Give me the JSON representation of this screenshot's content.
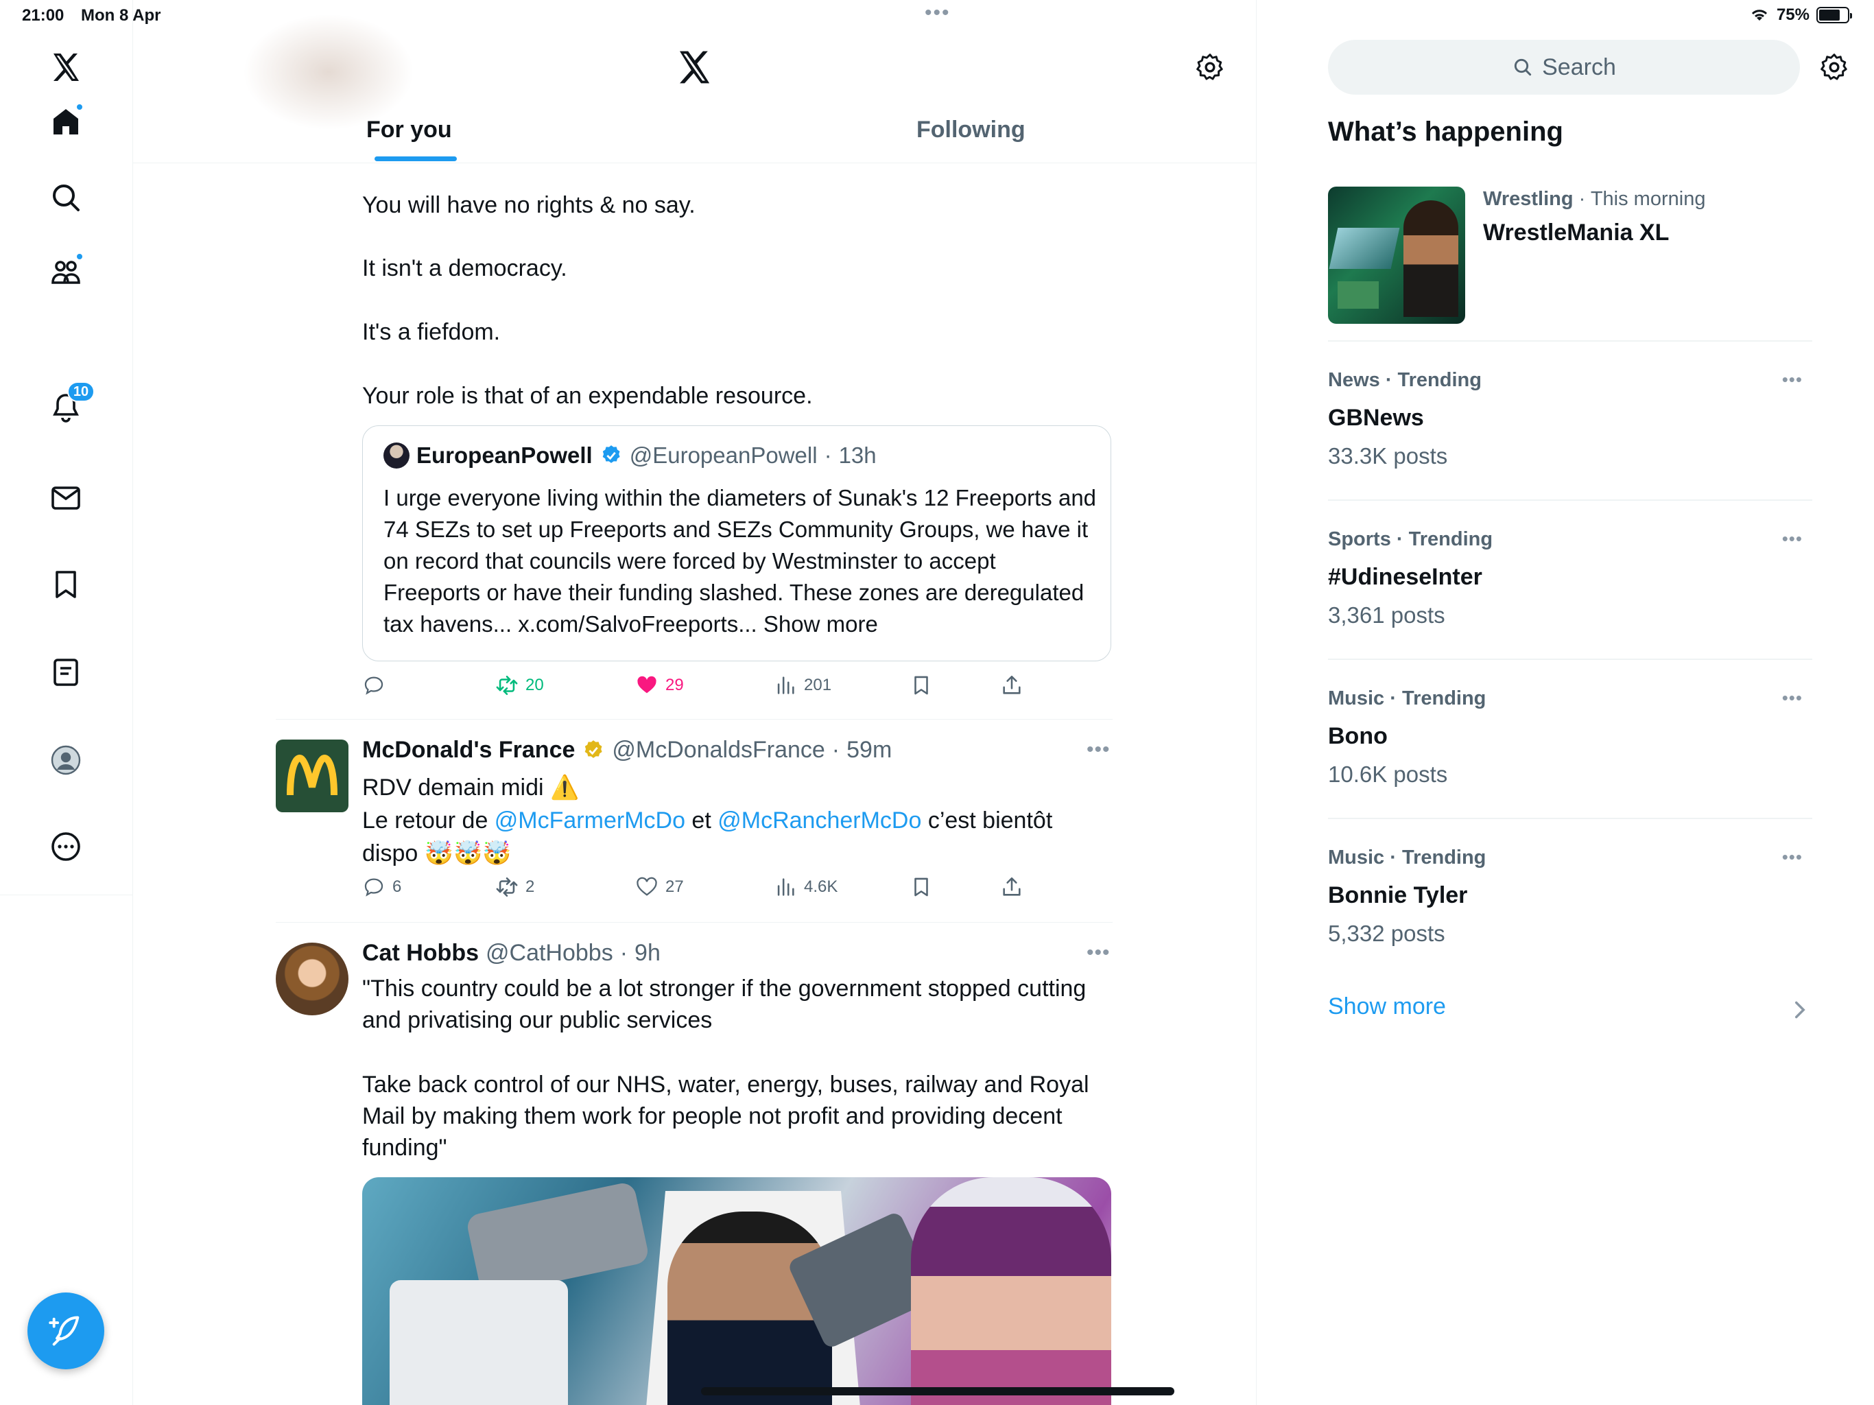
{
  "status": {
    "time": "21:00",
    "date": "Mon 8 Apr",
    "battery": "75%",
    "battery_level": 0.75
  },
  "nav": {
    "notifications_badge": "10",
    "icons": [
      "x-logo-icon",
      "home-icon",
      "search-icon",
      "communities-icon",
      "bell-icon",
      "mail-icon",
      "bookmark-icon",
      "lists-icon",
      "profile-icon",
      "more-icon"
    ]
  },
  "header": {
    "tabs": [
      {
        "label": "For you",
        "active": true
      },
      {
        "label": "Following",
        "active": false
      }
    ]
  },
  "tweet1": {
    "lines": [
      "You will have no rights & no say.",
      "It isn't a democracy.",
      "It's a fiefdom.",
      "Your role is that of an expendable resource."
    ],
    "quote": {
      "name": "EuropeanPowell",
      "handle": "@EuropeanPowell",
      "time": "13h",
      "body": "I urge everyone living within the diameters of Sunak's 12 Freeports and 74 SEZs to set up Freeports and SEZs Community Groups, we have it on record that councils were forced by Westminster to accept Freeports or have their funding slashed. These zones are deregulated tax havens... x.com/SalvoFreeports... Show more"
    },
    "reposts": "20",
    "likes": "29",
    "views": "201"
  },
  "tweet2": {
    "name": "McDonald's France",
    "handle": "@McDonaldsFrance",
    "time": "59m",
    "line1": "RDV demain midi ⚠️",
    "line2_prefix": "Le retour de ",
    "mention1": "@McFarmerMcDo",
    "line2_mid": " et ",
    "mention2": "@McRancherMcDo",
    "line2_suffix": " c’est bientôt",
    "line3": "dispo 🤯🤯🤯",
    "replies": "6",
    "reposts": "2",
    "likes": "27",
    "views": "4.6K"
  },
  "tweet3": {
    "name": "Cat Hobbs",
    "handle": "@CatHobbs",
    "time": "9h",
    "para1": "\"This country could be a lot stronger if the government stopped cutting and privatising our public services",
    "para2": "Take back control of our NHS, water, energy, buses, railway and Royal Mail by making them work for people not profit and providing decent funding\""
  },
  "sidebar": {
    "search_placeholder": "Search",
    "title": "What’s happening",
    "featured": {
      "category": "Wrestling",
      "time": "This morning",
      "name": "WrestleMania XL"
    },
    "trends": [
      {
        "category": "News · Trending",
        "name": "GBNews",
        "posts": "33.3K posts"
      },
      {
        "category": "Sports · Trending",
        "name": "#UdineseInter",
        "posts": "3,361 posts"
      },
      {
        "category": "Music · Trending",
        "name": "Bono",
        "posts": "10.6K posts"
      },
      {
        "category": "Music · Trending",
        "name": "Bonnie Tyler",
        "posts": "5,332 posts"
      }
    ],
    "show_more": "Show more"
  },
  "colors": {
    "accent": "#1d9bf0",
    "like": "#f91880",
    "repost": "#00ba7c",
    "text": "#0f1419",
    "muted": "#536471"
  }
}
